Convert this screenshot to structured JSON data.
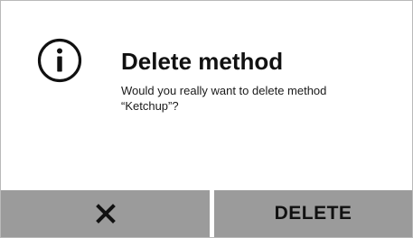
{
  "dialog": {
    "icon": "info-icon",
    "title": "Delete method",
    "message_lines": [
      "Would you really want to delete method",
      "“Ketchup”?"
    ]
  },
  "buttons": {
    "cancel_icon": "close-icon",
    "delete_label": "DELETE"
  },
  "colors": {
    "button_background": "#9b9b9b",
    "text": "#111111",
    "border": "#b9b9b9"
  }
}
